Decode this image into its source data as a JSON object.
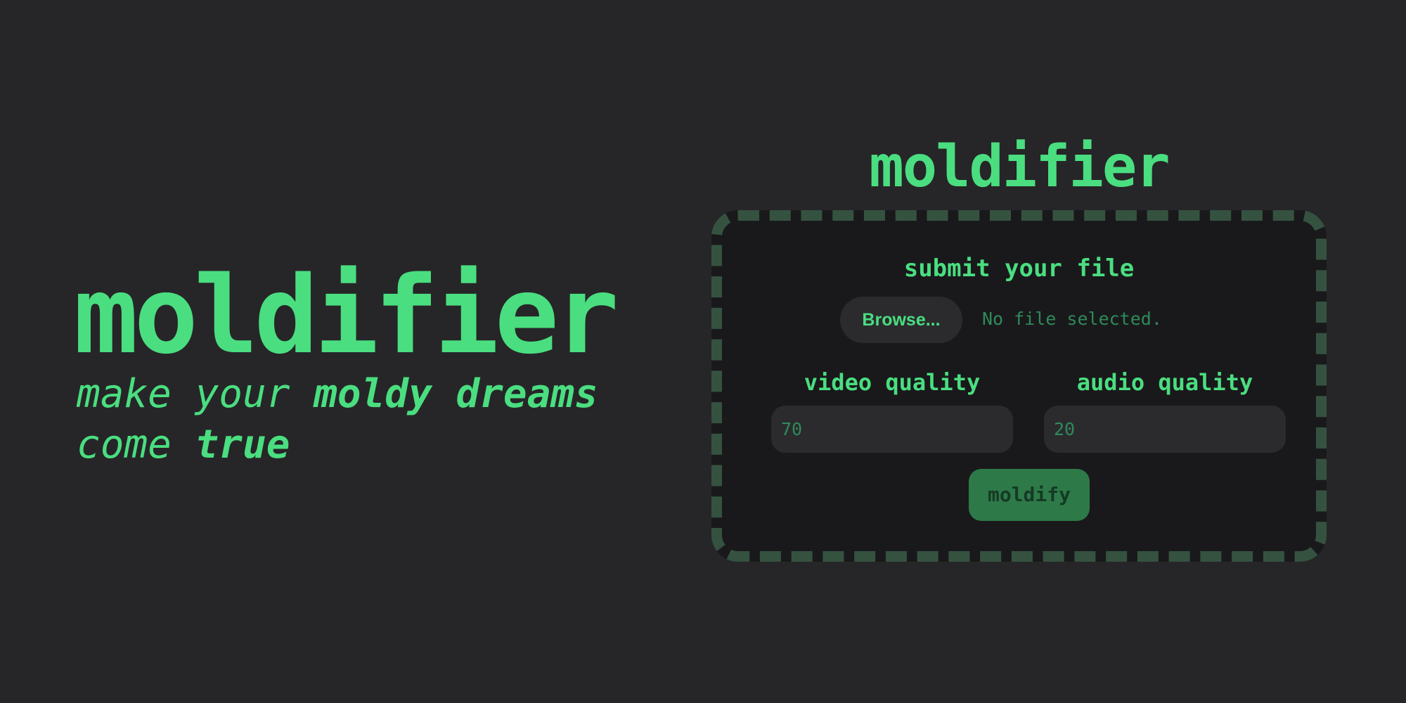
{
  "hero": {
    "title": "moldifier",
    "tagline": {
      "part1": "make your ",
      "part2_bold": "moldy dreams",
      "part3": " come ",
      "part4_bold": "true"
    }
  },
  "card": {
    "title": "moldifier",
    "submit_label": "submit your file",
    "browse_label": "Browse...",
    "file_status": "No file selected.",
    "video_quality": {
      "label": "video quality",
      "value": "70"
    },
    "audio_quality": {
      "label": "audio quality",
      "value": "20"
    },
    "action_label": "moldify"
  },
  "colors": {
    "accent": "#4ade80",
    "background": "#262628",
    "card_background": "#19191b",
    "card_border": "#355240",
    "input_background": "#2b2b2e",
    "muted_text": "#2f8a5a",
    "button_background": "#2d7a48",
    "button_text": "#153a24"
  }
}
